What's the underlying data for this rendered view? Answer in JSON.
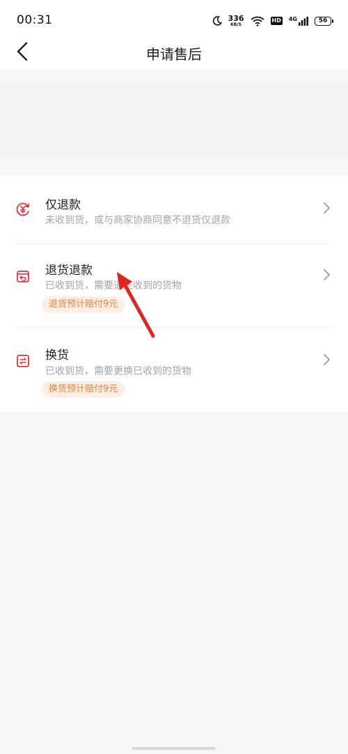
{
  "status_bar": {
    "time": "00:31",
    "speed_value": "336",
    "speed_unit": "KB/S",
    "hd": "HD",
    "network": "4G",
    "battery": "56"
  },
  "nav": {
    "title": "申请售后"
  },
  "options": [
    {
      "title": "仅退款",
      "desc": "未收到货，或与商家协商同意不退货仅退款",
      "icon": "refund-yen-icon"
    },
    {
      "title": "退货退款",
      "desc": "已收到货，需要退还收到的货物",
      "badge": "退货预计赔付9元",
      "icon": "return-box-icon"
    },
    {
      "title": "换货",
      "desc": "已收到货，需要更换已收到的货物",
      "badge": "换货预计赔付9元",
      "icon": "exchange-icon"
    }
  ],
  "colors": {
    "accent_red": "#e0323c",
    "badge_text": "#e8833a",
    "badge_bg": "#fdeee6",
    "annotation_arrow": "#e02424"
  }
}
